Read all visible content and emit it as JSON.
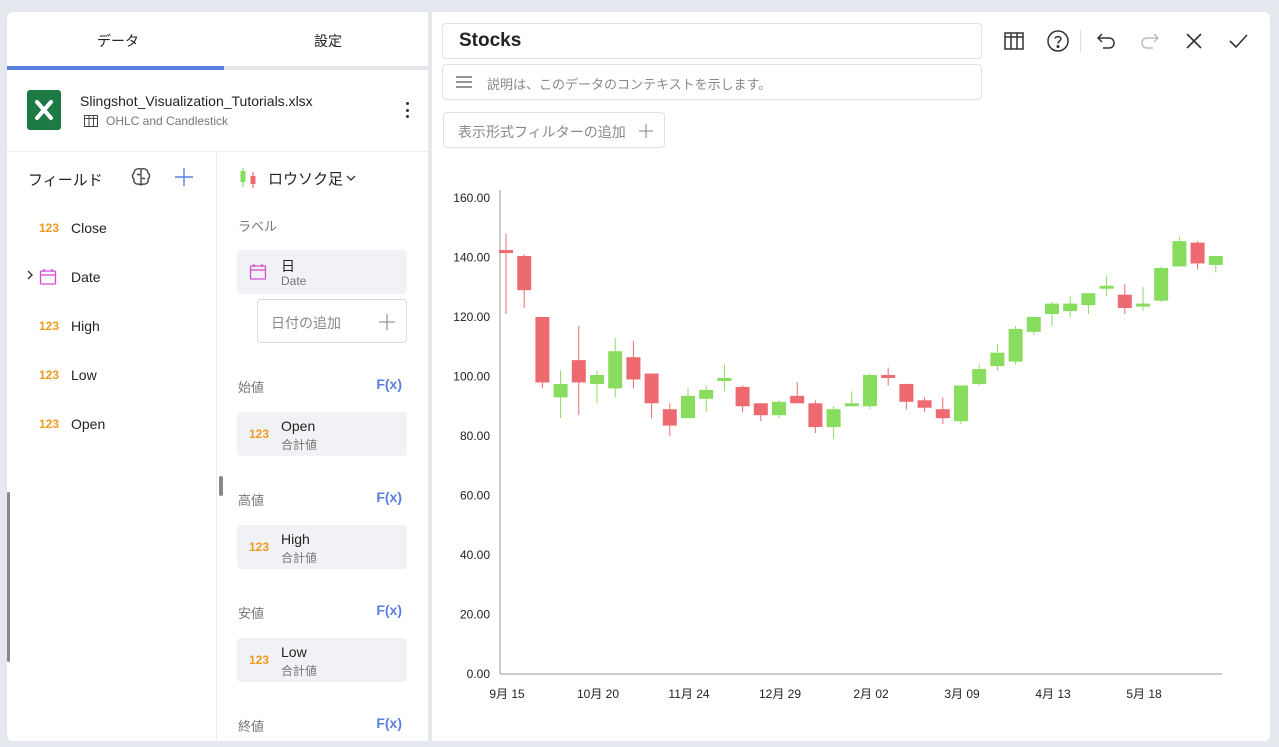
{
  "tabs": {
    "data": "データ",
    "settings": "設定"
  },
  "file": {
    "name": "Slingshot_Visualization_Tutorials.xlsx",
    "sheet": "OHLC and Candlestick"
  },
  "fields_panel": {
    "title": "フィールド",
    "items": [
      {
        "type": "123",
        "label": "Close"
      },
      {
        "type": "date",
        "label": "Date"
      },
      {
        "type": "123",
        "label": "High"
      },
      {
        "type": "123",
        "label": "Low"
      },
      {
        "type": "123",
        "label": "Open"
      }
    ]
  },
  "config": {
    "chart_type": "ロウソク足",
    "label_section": "ラベル",
    "label_field": {
      "title": "日",
      "sub": "Date"
    },
    "add_date": "日付の追加",
    "open_section": "始値",
    "open_field": {
      "title": "Open",
      "sub": "合計値"
    },
    "high_section": "高値",
    "high_field": {
      "title": "High",
      "sub": "合計値"
    },
    "low_section": "安値",
    "low_field": {
      "title": "Low",
      "sub": "合計値"
    },
    "close_section": "終値",
    "fx": "F(x)",
    "num_badge": "123"
  },
  "header": {
    "title": "Stocks",
    "description_placeholder": "説明は、このデータのコンテキストを示します。",
    "filter_button": "表示形式フィルターの追加"
  },
  "colors": {
    "accent": "#5b7fe0",
    "up": "#88dd5e",
    "down": "#ec6a70",
    "number": "#f09a20"
  },
  "chart_data": {
    "type": "candlestick",
    "title": "",
    "ylim": [
      0,
      160
    ],
    "y_ticks": [
      "0.00",
      "20.00",
      "40.00",
      "60.00",
      "80.00",
      "100.00",
      "120.00",
      "140.00",
      "160.00"
    ],
    "x_tick_labels": [
      {
        "index": 0,
        "label": "9月 15"
      },
      {
        "index": 5,
        "label": "10月 20"
      },
      {
        "index": 10,
        "label": "11月 24"
      },
      {
        "index": 15,
        "label": "12月 29"
      },
      {
        "index": 20,
        "label": "2月 02"
      },
      {
        "index": 25,
        "label": "3月 09"
      },
      {
        "index": 30,
        "label": "4月 13"
      },
      {
        "index": 35,
        "label": "5月 18"
      }
    ],
    "ohlc": [
      [
        142.5,
        148,
        121,
        141.5
      ],
      [
        140.5,
        141,
        123,
        129
      ],
      [
        120,
        120,
        96,
        98
      ],
      [
        93,
        102,
        86,
        97.5
      ],
      [
        105.5,
        117,
        87,
        98
      ],
      [
        97.5,
        102,
        91,
        100.5
      ],
      [
        96,
        113,
        93,
        108.5
      ],
      [
        106.5,
        112,
        96,
        99
      ],
      [
        101,
        101,
        86,
        91
      ],
      [
        89,
        91,
        80,
        83.5
      ],
      [
        86,
        96,
        86,
        93.5
      ],
      [
        92.5,
        97,
        88,
        95.5
      ],
      [
        98.5,
        104,
        95,
        99.5
      ],
      [
        96.5,
        97,
        88,
        90
      ],
      [
        91,
        91,
        85,
        87
      ],
      [
        87,
        92,
        86,
        91.5
      ],
      [
        93.5,
        98,
        91,
        91
      ],
      [
        91,
        92,
        81,
        83
      ],
      [
        83,
        90,
        79,
        89
      ],
      [
        90,
        95,
        90,
        91
      ],
      [
        90,
        101,
        89,
        100.5
      ],
      [
        100.5,
        103,
        97,
        99.5
      ],
      [
        97.5,
        97.5,
        89,
        91.5
      ],
      [
        92,
        93,
        88,
        89.5
      ],
      [
        89,
        93,
        84,
        86
      ],
      [
        85,
        97,
        84,
        97
      ],
      [
        97.5,
        104,
        97,
        102.5
      ],
      [
        103.5,
        111,
        102,
        108
      ],
      [
        105,
        117,
        104,
        116
      ],
      [
        115,
        120,
        114,
        120
      ],
      [
        121,
        125,
        117,
        124.5
      ],
      [
        122,
        127,
        120,
        124.5
      ],
      [
        124,
        128,
        121,
        128
      ],
      [
        129.5,
        134,
        127,
        130.5
      ],
      [
        127.5,
        131,
        121,
        123
      ],
      [
        123.5,
        130,
        122,
        124.5
      ],
      [
        125.5,
        137,
        125,
        136.5
      ],
      [
        137,
        147,
        137,
        145.5
      ],
      [
        145,
        145.5,
        136,
        138
      ],
      [
        137.5,
        140.5,
        135,
        140.5
      ]
    ]
  }
}
